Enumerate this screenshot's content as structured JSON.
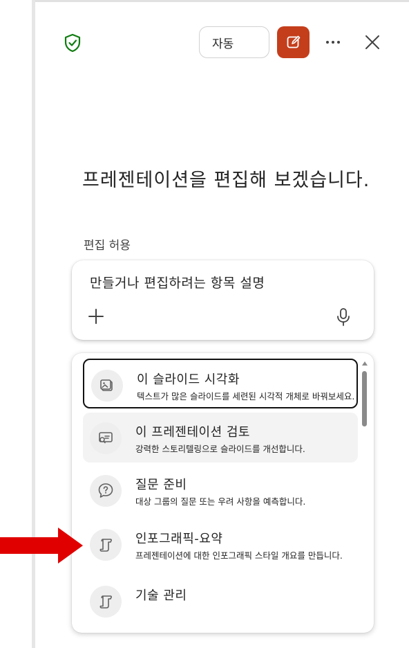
{
  "header": {
    "mode_label": "자동"
  },
  "headline": "프레젠테이션을 편집해 보겠습니다.",
  "edit_section": {
    "label": "편집 허용",
    "placeholder": "만들거나 편집하려는 항목 설명"
  },
  "menu": {
    "items": [
      {
        "title": "이 슬라이드 시각화",
        "description": "텍스트가 많은 슬라이드를 세련된 시각적 개체로 바꿔보세요.",
        "icon": "image-slide-icon"
      },
      {
        "title": "이 프레젠테이션 검토",
        "description": "강력한 스토리텔링으로 슬라이드를 개선합니다.",
        "icon": "review-slide-icon"
      },
      {
        "title": "질문 준비",
        "description": "대상 그룹의 질문 또는 우려 사항을 예측합니다.",
        "icon": "question-chat-icon"
      },
      {
        "title": "인포그래픽-요약",
        "description": "프레젠테이션에 대한 인포그래픽 스타일 개요를 만듭니다.",
        "icon": "scroll-icon"
      },
      {
        "title": "기술 관리",
        "description": "",
        "icon": "scroll-icon"
      }
    ]
  },
  "colors": {
    "accent": "#c43e1c",
    "shield": "#107c10",
    "annotation_arrow": "#e00000"
  }
}
